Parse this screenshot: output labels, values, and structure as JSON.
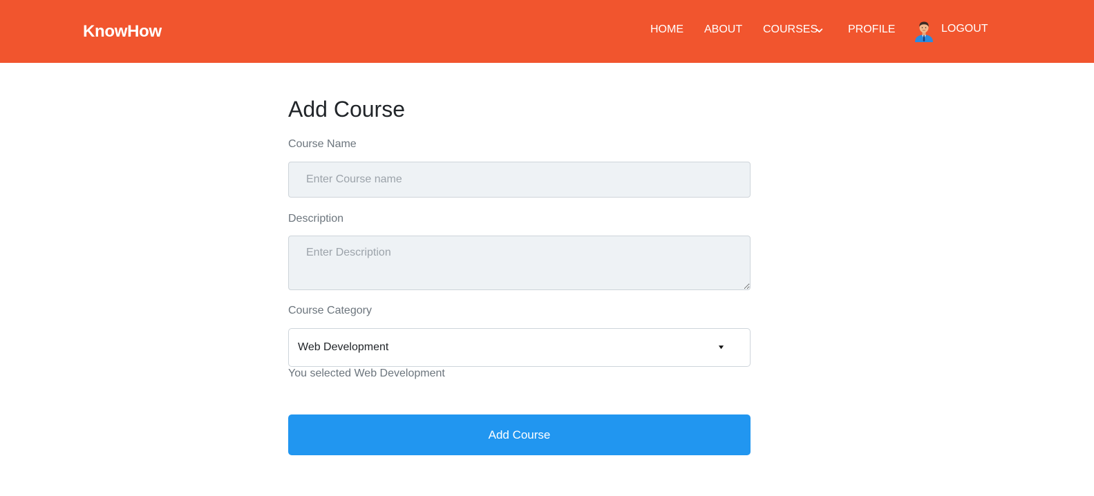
{
  "navbar": {
    "brand": "KnowHow",
    "links": {
      "home": "HOME",
      "about": "ABOUT",
      "courses": "COURSES",
      "profile": "PROFILE",
      "logout": "LOGOUT"
    },
    "icons": {
      "courses_dropdown": "chevron-down-icon",
      "user": "avatar-icon"
    }
  },
  "form": {
    "title": "Add Course",
    "course_name": {
      "label": "Course Name",
      "placeholder": "Enter Course name",
      "value": ""
    },
    "description": {
      "label": "Description",
      "placeholder": "Enter Description",
      "value": ""
    },
    "category": {
      "label": "Course Category",
      "selected": "Web Development",
      "selection_message": "You selected Web Development"
    },
    "submit_label": "Add Course"
  },
  "colors": {
    "navbar_bg": "#f1552e",
    "button_bg": "#2196f0",
    "input_bg": "#eef2f5",
    "label_text": "#6c757d"
  }
}
